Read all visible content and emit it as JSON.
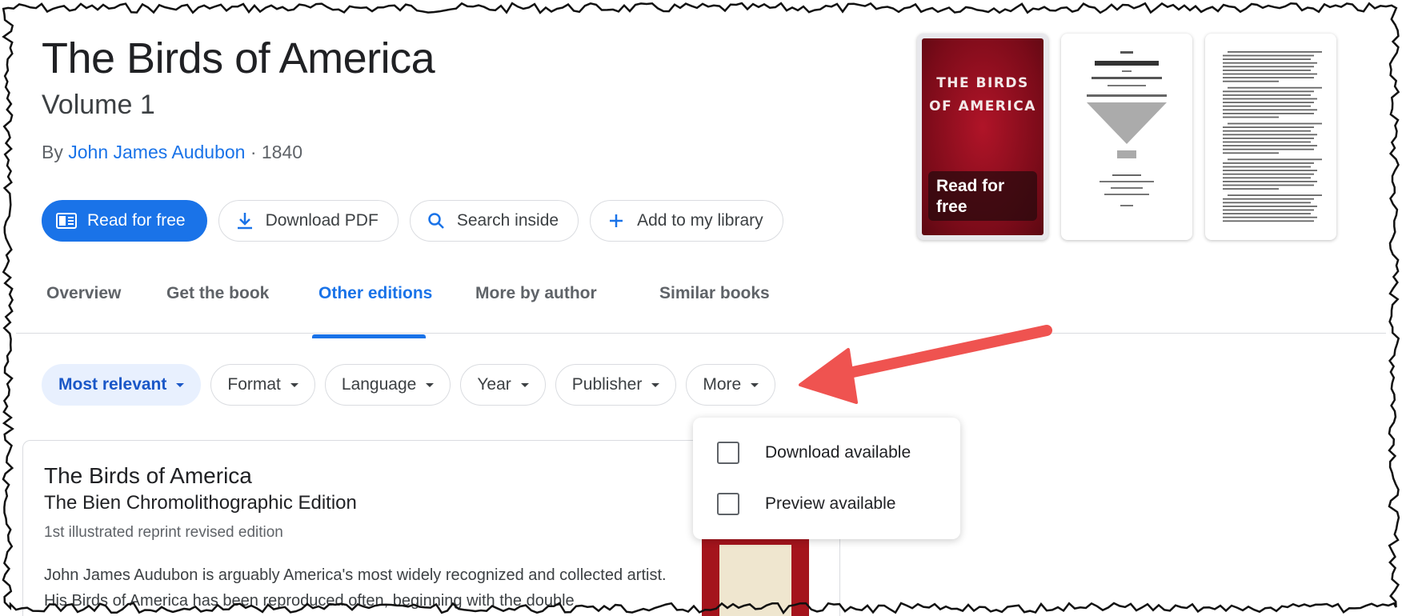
{
  "book": {
    "title": "The Birds of America",
    "subtitle": "Volume 1",
    "by_prefix": "By ",
    "author": "John James Audubon",
    "year_sep": " · 1840"
  },
  "actions": [
    {
      "label": "Read for free",
      "icon": "book-open-icon"
    },
    {
      "label": "Download PDF",
      "icon": "download-icon"
    },
    {
      "label": "Search inside",
      "icon": "search-icon"
    },
    {
      "label": "Add to my library",
      "icon": "plus-icon"
    }
  ],
  "thumbnails": {
    "cover_title": "THE BIRDS OF AMERICA",
    "cover_action": "Read for free"
  },
  "tabs": [
    {
      "label": "Overview",
      "active": false
    },
    {
      "label": "Get the book",
      "active": false
    },
    {
      "label": "Other editions",
      "active": true
    },
    {
      "label": "More by author",
      "active": false
    },
    {
      "label": "Similar books",
      "active": false
    }
  ],
  "filters": [
    {
      "label": "Most relevant",
      "selected": true
    },
    {
      "label": "Format",
      "selected": false
    },
    {
      "label": "Language",
      "selected": false
    },
    {
      "label": "Year",
      "selected": false
    },
    {
      "label": "Publisher",
      "selected": false
    },
    {
      "label": "More",
      "selected": false
    }
  ],
  "more_menu": [
    {
      "label": "Download available",
      "checked": false
    },
    {
      "label": "Preview available",
      "checked": false
    }
  ],
  "result": {
    "title": "The Birds of America",
    "subtitle": "The Bien Chromolithographic Edition",
    "edition": "1st illustrated reprint revised edition",
    "description": "John James Audubon is arguably America's most widely recognized and collected artist. His Birds of America has been reproduced often, beginning with the double"
  },
  "colors": {
    "accent": "#1a73e8",
    "annotation_arrow": "#ef5350",
    "cover_red": "#8b0f1e"
  }
}
